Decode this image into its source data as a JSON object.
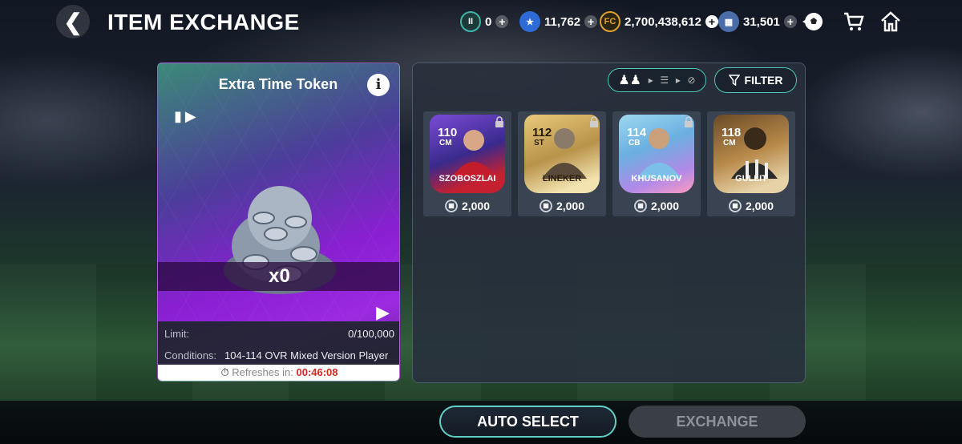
{
  "header": {
    "title": "ITEM EXCHANGE",
    "back_icon": "chevron-left-icon",
    "currencies": [
      {
        "name": "token",
        "value": "0",
        "color": "#3fb4a8"
      },
      {
        "name": "energy",
        "value": "11,762",
        "color": "#2f6bd6"
      },
      {
        "name": "fc-coins",
        "value": "2,700,438,612",
        "color": "#e0a12a"
      },
      {
        "name": "points",
        "value": "31,501",
        "color": "#4a6ca8"
      }
    ]
  },
  "item": {
    "name": "Extra Time Token",
    "quantity": "x0",
    "limit_label": "Limit:",
    "limit_value": "0/100,000",
    "conditions_label": "Conditions:",
    "conditions_value": "104-114 OVR Mixed Version Player",
    "refresh_label": "Refreshes in:",
    "refresh_time": "00:46:08"
  },
  "filter_label": "FILTER",
  "players": [
    {
      "ovr": "110",
      "pos": "CM",
      "name": "SZOBOSZLAI",
      "price": "2,000",
      "theme": "purple"
    },
    {
      "ovr": "112",
      "pos": "ST",
      "name": "LINEKER",
      "price": "2,000",
      "theme": "gold"
    },
    {
      "ovr": "114",
      "pos": "CB",
      "name": "KHUSANOV",
      "price": "2,000",
      "theme": "blue"
    },
    {
      "ovr": "118",
      "pos": "CM",
      "name": "GULLIT",
      "price": "2,000",
      "theme": "bronze"
    }
  ],
  "buttons": {
    "auto_select": "AUTO SELECT",
    "exchange": "EXCHANGE"
  }
}
